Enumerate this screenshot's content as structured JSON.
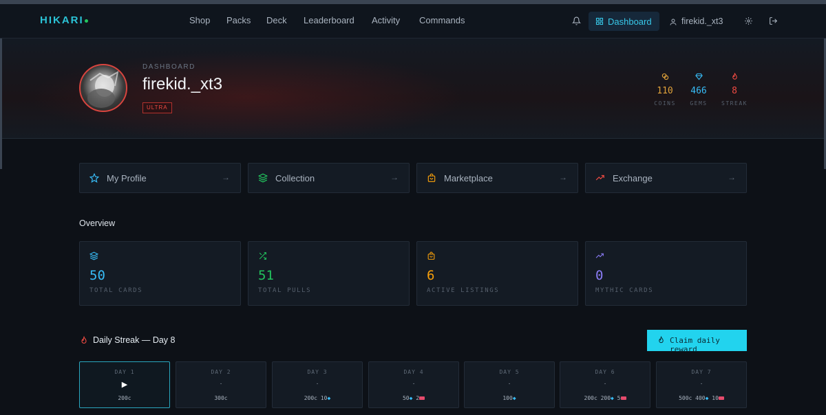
{
  "header": {
    "brand": "HIKARI",
    "nav": [
      "Shop",
      "Packs",
      "Deck",
      "Leaderboard",
      "Activity",
      "Commands"
    ],
    "dashboard_label": "Dashboard",
    "username": "firekid._xt3"
  },
  "hero": {
    "kicker": "DASHBOARD",
    "name": "firekid._xt3",
    "badge": "ULTRA",
    "stats": [
      {
        "value": "110",
        "label": "COINS",
        "color": "#e0a23a",
        "icon": "coins-icon"
      },
      {
        "value": "466",
        "label": "GEMS",
        "color": "#38bdf8",
        "icon": "gem-icon"
      },
      {
        "value": "8",
        "label": "STREAK",
        "color": "#ef4a42",
        "icon": "flame-icon"
      }
    ]
  },
  "quick_links": [
    {
      "label": "My Profile",
      "icon": "star-icon",
      "color": "#38bdf8"
    },
    {
      "label": "Collection",
      "icon": "layers-icon",
      "color": "#22c55e"
    },
    {
      "label": "Marketplace",
      "icon": "shopping-bag-icon",
      "color": "#f59e0b"
    },
    {
      "label": "Exchange",
      "icon": "trending-up-icon",
      "color": "#ef4a42"
    }
  ],
  "overview": {
    "title": "Overview",
    "cards": [
      {
        "value": "50",
        "label": "TOTAL CARDS",
        "color": "#38bdf8",
        "icon": "layers-icon"
      },
      {
        "value": "51",
        "label": "TOTAL PULLS",
        "color": "#22c55e",
        "icon": "shuffle-icon"
      },
      {
        "value": "6",
        "label": "ACTIVE LISTINGS",
        "color": "#f59e0b",
        "icon": "shopping-bag-icon"
      },
      {
        "value": "0",
        "label": "MYTHIC CARDS",
        "color": "#8b7cf6",
        "icon": "trending-up-icon"
      }
    ]
  },
  "streak": {
    "title": "Daily Streak — Day 8",
    "claim_label": "Claim daily reward",
    "days": [
      {
        "label": "DAY 1",
        "mark": "▶",
        "reward": [
          "200c"
        ]
      },
      {
        "label": "DAY 2",
        "mark": "·",
        "reward": [
          "300c"
        ]
      },
      {
        "label": "DAY 3",
        "mark": "·",
        "reward": [
          "200c 10",
          "gem"
        ]
      },
      {
        "label": "DAY 4",
        "mark": "·",
        "reward": [
          "50",
          "gem",
          " 2",
          "ticket"
        ]
      },
      {
        "label": "DAY 5",
        "mark": "·",
        "reward": [
          "100",
          "gem"
        ]
      },
      {
        "label": "DAY 6",
        "mark": "·",
        "reward": [
          "200c 200",
          "gem",
          " 5",
          "ticket"
        ]
      },
      {
        "label": "DAY 7",
        "mark": "·",
        "reward": [
          "500c 400",
          "gem",
          " 10",
          "ticket"
        ]
      }
    ]
  }
}
